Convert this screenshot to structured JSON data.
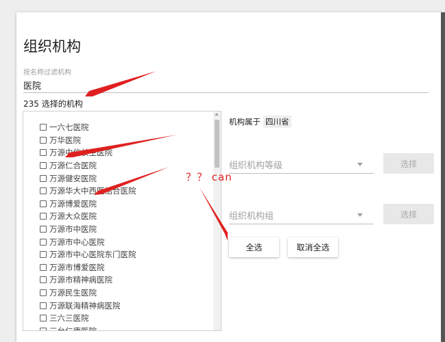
{
  "dialog": {
    "title": "组织机构",
    "filter_label": "按名称过滤机构",
    "filter_value": "医院",
    "selected_count_label": "235 选择的机构"
  },
  "org_list": {
    "items": [
      "一六七医院",
      "万华医院",
      "万源中信长生医院",
      "万源仁合医院",
      "万源健安医院",
      "万源华大中西医结合医院",
      "万源博爱医院",
      "万源大众医院",
      "万源市中医院",
      "万源市中心医院",
      "万源市中心医院东门医院",
      "万源市博爱医院",
      "万源市精神病医院",
      "万源民生医院",
      "万源联海精神病医院",
      "三六三医院",
      "三台仁康医院"
    ]
  },
  "right_panel": {
    "belongs_label": "机构属于",
    "province": "四川省",
    "level_placeholder": "组织机构等级",
    "group_placeholder": "组织机构组",
    "choose_label": "选择",
    "select_all_label": "全选",
    "deselect_all_label": "取消全选"
  },
  "annotation": {
    "text": "？？ can",
    "color": "#e02020"
  }
}
